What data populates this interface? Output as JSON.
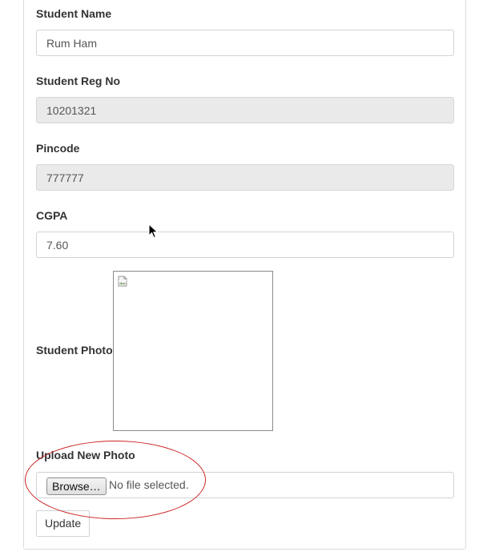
{
  "form": {
    "student_name": {
      "label": "Student Name",
      "value": "Rum Ham"
    },
    "reg_no": {
      "label": "Student Reg No",
      "value": "10201321"
    },
    "pincode": {
      "label": "Pincode",
      "value": "777777"
    },
    "cgpa": {
      "label": "CGPA",
      "value": "7.60"
    },
    "photo": {
      "label": "Student Photo",
      "icon": "broken-image-icon"
    },
    "upload": {
      "label": "Upload New Photo",
      "browse_label": "Browse…",
      "status": "No file selected."
    },
    "update_label": "Update"
  },
  "colors": {
    "annotation": "#cc2222",
    "readonly_bg": "#eaeaea",
    "border": "#cfd4d8"
  }
}
